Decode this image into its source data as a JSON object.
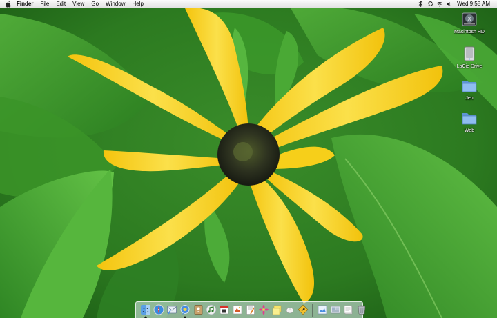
{
  "menubar": {
    "app_name": "Finder",
    "items": [
      "File",
      "Edit",
      "View",
      "Go",
      "Window",
      "Help"
    ],
    "clock": "Wed 9:58 AM",
    "status_icons": [
      "bluetooth-icon",
      "sync-icon",
      "wifi-icon",
      "volume-icon"
    ]
  },
  "desktop": {
    "icons": [
      {
        "label": "Macintosh HD",
        "icon": "hard-drive-icon"
      },
      {
        "label": "LaCie Drive",
        "icon": "external-drive-icon"
      },
      {
        "label": "Jen",
        "icon": "folder-icon"
      },
      {
        "label": "Web",
        "icon": "folder-icon"
      }
    ],
    "wallpaper": "yellow-daisy-on-green-leaves"
  },
  "dock": {
    "apps": [
      "finder-icon",
      "safari-icon",
      "mail-icon",
      "ichat-icon",
      "address-book-icon",
      "itunes-icon",
      "ical-icon",
      "iphoto-icon",
      "text-edit-icon",
      "flower-app-icon",
      "stickies-icon",
      "mouse-icon",
      "mapping-icon",
      "preview-icon",
      "file-sharing-icon",
      "documents-stack-icon",
      "trash-icon"
    ]
  },
  "colors": {
    "menubar": "#efefef",
    "petal": "#f7d21e",
    "leaf": "#3f9a2c",
    "folder": "#7fb2e6"
  }
}
